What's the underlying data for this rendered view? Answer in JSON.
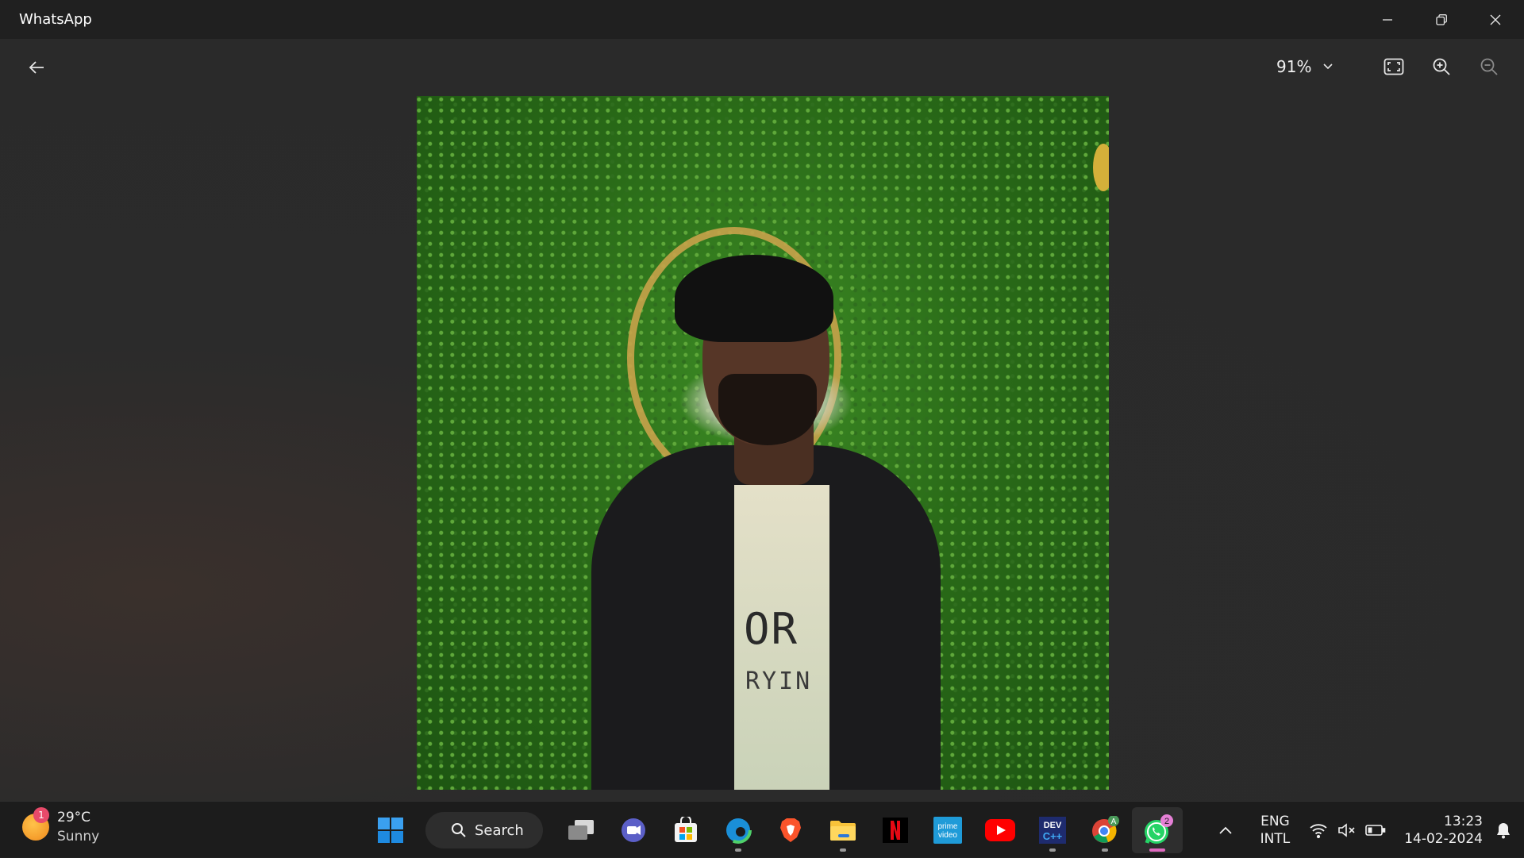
{
  "window": {
    "title": "WhatsApp",
    "controls": [
      "minimize",
      "restore",
      "close"
    ]
  },
  "toolbar": {
    "back_icon": "arrow-left-icon",
    "zoom_level": "91%",
    "zoom_dropdown_icon": "chevron-down-icon",
    "fit_icon": "fit-to-screen-icon",
    "zoom_in_icon": "zoom-in-icon",
    "zoom_out_icon": "zoom-out-icon"
  },
  "photo": {
    "shirt_text": [
      "OR",
      "RYIN"
    ],
    "description_icon": "photo"
  },
  "taskbar": {
    "weather": {
      "temperature": "29°C",
      "condition": "Sunny",
      "badge": "1"
    },
    "search_label": "Search",
    "apps": [
      {
        "name": "start",
        "icon": "windows-icon"
      },
      {
        "name": "task-view",
        "icon": "task-view-icon"
      },
      {
        "name": "teams",
        "icon": "teams-icon"
      },
      {
        "name": "microsoft-store",
        "icon": "store-icon"
      },
      {
        "name": "edge",
        "icon": "edge-icon"
      },
      {
        "name": "brave",
        "icon": "brave-icon"
      },
      {
        "name": "file-explorer",
        "icon": "folder-icon"
      },
      {
        "name": "netflix",
        "icon": "netflix-icon"
      },
      {
        "name": "prime-video",
        "icon": "prime-video-icon",
        "label": "prime video"
      },
      {
        "name": "youtube",
        "icon": "youtube-icon"
      },
      {
        "name": "dev-cpp",
        "icon": "devcpp-icon",
        "label": "DEV C++"
      },
      {
        "name": "chrome",
        "icon": "chrome-icon",
        "badge": "A"
      },
      {
        "name": "whatsapp",
        "icon": "whatsapp-icon",
        "badge": "2"
      }
    ],
    "tray": {
      "language_line1": "ENG",
      "language_line2": "INTL",
      "time": "13:23",
      "date": "14-02-2024"
    }
  },
  "colors": {
    "accent_active": "#e06ac0",
    "whatsapp_green": "#25d366",
    "netflix_red": "#e50914",
    "youtube_red": "#ff0000"
  }
}
